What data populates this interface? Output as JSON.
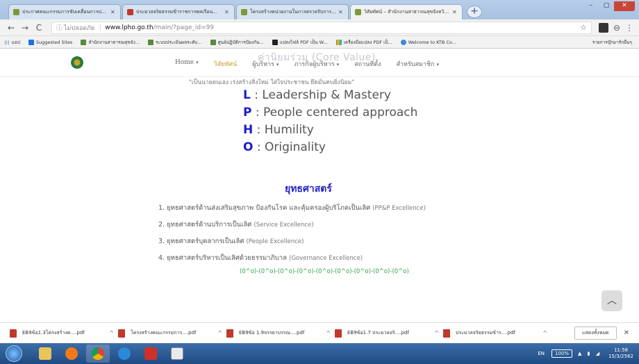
{
  "browser": {
    "tabs": [
      {
        "label": "ประกาศคณะกรรมการขับเคลื่อนการป...",
        "icon": "site",
        "active": false
      },
      {
        "label": "ประมวลจริยธรรมข้าราชการพลเรือน...",
        "icon": "pdf",
        "active": false
      },
      {
        "label": "โครงสร้างหน่วยงานในการตรวจรับการ...",
        "icon": "site",
        "active": false
      },
      {
        "label": "วิสัยทัศน์ – สำนักงานสาธารณสุขจังหวัด...",
        "icon": "site",
        "active": true
      }
    ],
    "new_tab": "+",
    "window_controls": [
      "–",
      "▢",
      "✕"
    ],
    "back": "←",
    "forward": "→",
    "reload": "C",
    "secure_label": "ไม่ปลอดภัย",
    "url_host": "www.lpho.go.th",
    "url_path": "/main/?page_id=99",
    "star": "☆",
    "menu": "⋮"
  },
  "bookmarks": [
    {
      "label": "แอป",
      "icon": "apps"
    },
    {
      "label": "Suggested Sites",
      "icon": "blue"
    },
    {
      "label": "สำนักงานสาธารณสุขจัง...",
      "icon": "site"
    },
    {
      "label": "ระบบประเมินผลระดับ...",
      "icon": "site"
    },
    {
      "label": "ศูนย์ปฏิบัติการป้องกัน...",
      "icon": "site"
    },
    {
      "label": "แปลงไฟล์ PDF เป็น W...",
      "icon": "black"
    },
    {
      "label": "เครื่องมือแปลง PDF เป็...",
      "icon": "multi"
    },
    {
      "label": "Welcome to KTB Co...",
      "icon": "globe"
    }
  ],
  "bookmarks_right": "รายการบุ๊กมาร์กอื่นๆ",
  "site_nav": {
    "items": [
      {
        "label": "Home",
        "caret": true,
        "active": false
      },
      {
        "label": "วิสัยทัศน์",
        "caret": false,
        "active": true
      },
      {
        "label": "ผู้บริหาร",
        "caret": true,
        "active": false
      },
      {
        "label": "ภารกิจผู้บริหาร",
        "caret": true,
        "active": false
      },
      {
        "label": "สถานที่ตั้ง",
        "caret": false,
        "active": false
      },
      {
        "label": "สำหรับสมาชิก",
        "caret": true,
        "active": false
      }
    ],
    "overlay_title": "ค่านิยมร่วม (Core Value)",
    "caret": "▾"
  },
  "content": {
    "motto": "\"เป็นนายตนเอง เร่งสร้างสิ่งใหม่ ใส่ใจประชาชน ยึดมั่นคนยิ่งนิยม\"",
    "core_values": [
      {
        "letter": "L",
        "text": ": Leadership & Mastery"
      },
      {
        "letter": "P",
        "text": ": People centered approach"
      },
      {
        "letter": "H",
        "text": ": Humility"
      },
      {
        "letter": "O",
        "text": ": Originality"
      }
    ],
    "strategy_title": "ยุทธศาสตร์",
    "strategies": [
      {
        "th": "1. ยุทธศาสตร์ด้านส่งเสริมสุขภาพ ป้องกันโรค และคุ้มครองผู้บริโภคเป็นเลิศ",
        "en": "(PP&P Excellence)"
      },
      {
        "th": "2. ยุทธศาสตร์ด้านบริการเป็นเลิศ",
        "en": "(Service Excellence)"
      },
      {
        "th": "3. ยุทธศาสตร์บุคลากรเป็นเลิศ",
        "en": "(People Excellence)"
      },
      {
        "th": "4. ยุทธศาสตร์บริหารเป็นเลิศด้วยธรรมาภิบาล",
        "en": "(Governance Excellence)"
      }
    ],
    "divider": "(0^o)-(0^o)-(0^o)-(0^o)-(0^o)-(0^o)-(0^o)-(0^o)-(0^o)",
    "scroll_top": "︿"
  },
  "downloads": {
    "items": [
      "EB9ข้อ1.3โครงสร้างค....pdf",
      "โครงสร้างคณะกรรมการ....pdf",
      "EB9ข้อ 1.9จรรยาบรรณ....pdf",
      "EB9ข้อ1.7 ประมวลจริ....pdf",
      "ประมวลจริยธรรมข้าร....pdf"
    ],
    "caret": "^",
    "show_all": "แสดงทั้งหมด",
    "close": "✕"
  },
  "taskbar": {
    "lang": "EN",
    "zoom": "100%",
    "tray_icons": "▲ ▮ ◢",
    "time": "11:58",
    "date": "15/3/2562"
  }
}
